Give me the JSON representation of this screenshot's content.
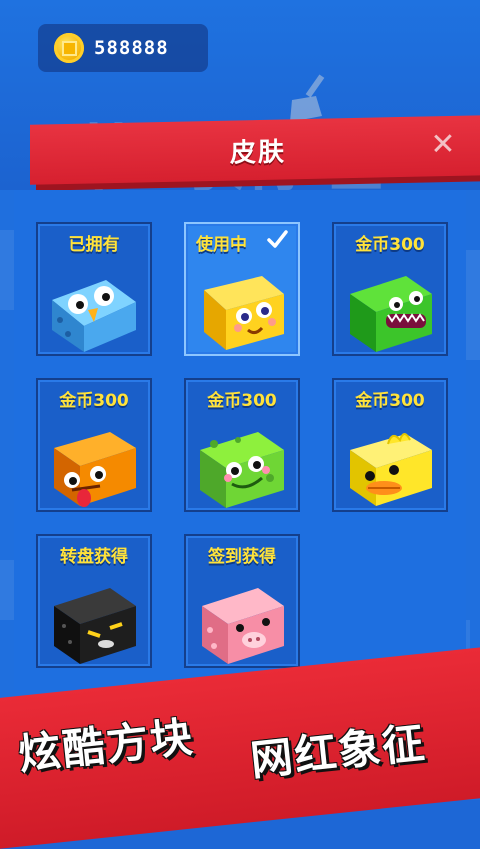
{
  "coins": {
    "value": "588888"
  },
  "header": {
    "title": "皮肤",
    "close_symbol": "✕"
  },
  "faded_title": "节约清理",
  "skins": [
    {
      "label": "已拥有",
      "character": "blue-bird",
      "selected": false
    },
    {
      "label": "使用中",
      "character": "yellow-block",
      "selected": true
    },
    {
      "label": "金币300",
      "character": "green-monster",
      "selected": false
    },
    {
      "label": "金币300",
      "character": "orange-monster",
      "selected": false
    },
    {
      "label": "金币300",
      "character": "green-frog",
      "selected": false
    },
    {
      "label": "金币300",
      "character": "yellow-duck",
      "selected": false
    },
    {
      "label": "转盘获得",
      "character": "black-cat",
      "selected": false
    },
    {
      "label": "签到获得",
      "character": "pink-pig",
      "selected": false
    }
  ],
  "banner": {
    "left_text": "炫酷方块",
    "right_text": "网红象征"
  },
  "colors": {
    "accent_red": "#d6202f",
    "panel_blue": "#1e6fe0",
    "label_yellow": "#ffe23a"
  }
}
